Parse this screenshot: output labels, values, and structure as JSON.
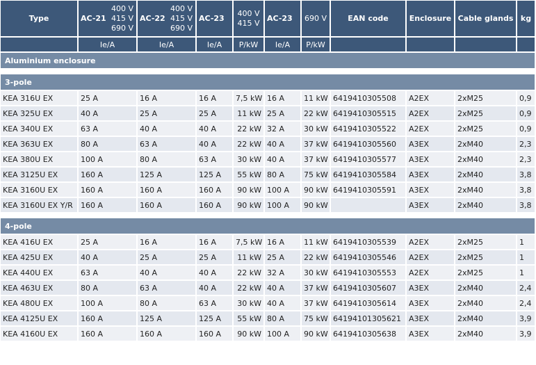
{
  "header": {
    "type": "Type",
    "ac21": "AC-21",
    "ac22": "AC-22",
    "ac23": "AC-23",
    "ac23b": "AC-23",
    "v400": "400 V",
    "v415": "415 V",
    "v690": "690 V",
    "v400b": "400 V",
    "v415b": "415 V",
    "v690b": "690 V",
    "v400c": "400 V",
    "v415c": "415 V",
    "v690c": "690 V",
    "v400d": "400 V",
    "v415d": "415 V",
    "v690only": "690 V",
    "ean": "EAN code",
    "enclosure": "Enclosure",
    "glands": "Cable glands",
    "kg": "kg",
    "units": [
      "",
      "Ie/A",
      "Ie/A",
      "Ie/A",
      "P/kW",
      "Ie/A",
      "P/kW",
      "",
      "",
      "",
      ""
    ]
  },
  "category": "Aluminium enclosure",
  "sections": [
    {
      "title": "3-pole",
      "rows": [
        [
          "KEA 316U EX",
          "25 A",
          "16 A",
          "16 A",
          "7,5 kW",
          "16 A",
          "11 kW",
          "6419410305508",
          "A2EX",
          "2xM25",
          "0,9"
        ],
        [
          "KEA 325U EX",
          "40 A",
          "25 A",
          "25 A",
          "11 kW",
          "25 A",
          "22 kW",
          "6419410305515",
          "A2EX",
          "2xM25",
          "0,9"
        ],
        [
          "KEA 340U EX",
          "63 A",
          "40 A",
          "40 A",
          "22 kW",
          "32 A",
          "30 kW",
          "6419410305522",
          "A2EX",
          "2xM25",
          "0,9"
        ],
        [
          "KEA 363U EX",
          "80 A",
          "63 A",
          "40 A",
          "22 kW",
          "40 A",
          "37 kW",
          "6419410305560",
          "A3EX",
          "2xM40",
          "2,3"
        ],
        [
          "KEA 380U EX",
          "100 A",
          "80 A",
          "63 A",
          "30 kW",
          "40 A",
          "37 kW",
          "6419410305577",
          "A3EX",
          "2xM40",
          "2,3"
        ],
        [
          "KEA 3125U EX",
          "160 A",
          "125 A",
          "125 A",
          "55 kW",
          "80 A",
          "75 kW",
          "6419410305584",
          "A3EX",
          "2xM40",
          "3,8"
        ],
        [
          "KEA 3160U EX",
          "160 A",
          "160 A",
          "160 A",
          "90 kW",
          "100 A",
          "90 kW",
          "6419410305591",
          "A3EX",
          "2xM40",
          "3,8"
        ],
        [
          "KEA 3160U EX Y/R",
          "160 A",
          "160 A",
          "160 A",
          "90 kW",
          "100 A",
          "90 kW",
          "",
          "A3EX",
          "2xM40",
          "3,8"
        ]
      ]
    },
    {
      "title": "4-pole",
      "rows": [
        [
          "KEA 416U EX",
          "25 A",
          "16 A",
          "16 A",
          "7,5 kW",
          "16 A",
          "11 kW",
          "6419410305539",
          "A2EX",
          "2xM25",
          "1"
        ],
        [
          "KEA 425U EX",
          "40 A",
          "25 A",
          "25 A",
          "11 kW",
          "25 A",
          "22 kW",
          "6419410305546",
          "A2EX",
          "2xM25",
          "1"
        ],
        [
          "KEA 440U EX",
          "63 A",
          "40 A",
          "40 A",
          "22 kW",
          "32 A",
          "30 kW",
          "6419410305553",
          "A2EX",
          "2xM25",
          "1"
        ],
        [
          "KEA 463U EX",
          "80 A",
          "63 A",
          "40 A",
          "22 kW",
          "40 A",
          "37 kW",
          "6419410305607",
          "A3EX",
          "2xM40",
          "2,4"
        ],
        [
          "KEA 480U EX",
          "100 A",
          "80 A",
          "63 A",
          "30 kW",
          "40 A",
          "37 kW",
          "6419410305614",
          "A3EX",
          "2xM40",
          "2,4"
        ],
        [
          "KEA 4125U EX",
          "160 A",
          "125 A",
          "125 A",
          "55 kW",
          "80 A",
          "75 kW",
          "64194101305621",
          "A3EX",
          "2xM40",
          "3,9"
        ],
        [
          "KEA 4160U EX",
          "160 A",
          "160 A",
          "160 A",
          "90 kW",
          "100 A",
          "90 kW",
          "6419410305638",
          "A3EX",
          "2xM40",
          "3,9"
        ]
      ]
    }
  ]
}
